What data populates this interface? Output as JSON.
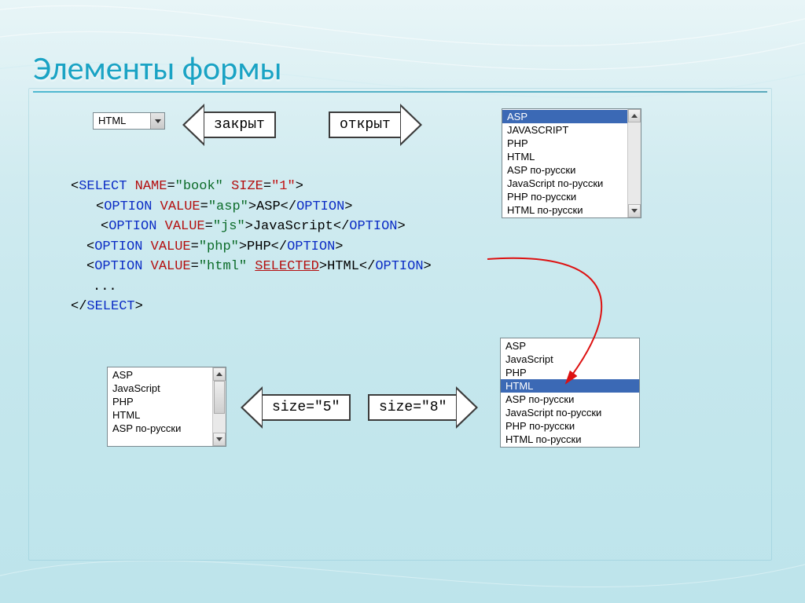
{
  "title": "Элементы формы",
  "arrows": {
    "closed": "закрыт",
    "open": "открыт",
    "size5": "size=\"5\"",
    "size8": "size=\"8\""
  },
  "select_closed_value": "HTML",
  "list_open": {
    "selected_index": 0,
    "items": [
      "ASP",
      "JAVASCRIPT",
      "PHP",
      "HTML",
      "ASP по-русски",
      "JavaScript по-русски",
      "PHP по-русски",
      "HTML по-русски"
    ]
  },
  "list5": {
    "items": [
      "ASP",
      "JavaScript",
      "PHP",
      "HTML",
      "ASP по-русски"
    ],
    "scroll_thumb": {
      "top": 0,
      "height": 50
    }
  },
  "list8": {
    "selected_index": 3,
    "items": [
      "ASP",
      "JavaScript",
      "PHP",
      "HTML",
      "ASP по-русски",
      "JavaScript по-русски",
      "PHP по-русски",
      "HTML по-русски"
    ]
  },
  "code": {
    "l1_pre": "<",
    "l1_tag": "SELECT",
    "l1_sp": " NAME=",
    "l1_nameval": "\"book\"",
    "l1_size": " SIZE=",
    "l1_sizeval": "\"1\"",
    "l1_post": ">",
    "opt1_open": "<OPTION VALUE=",
    "opt1_val": "\"asp\"",
    "opt1_mid": ">ASP</",
    "opt1_close": "OPTION",
    "opt2_open": "<OPTION VALUE=",
    "opt2_val": "\"js\"",
    "opt2_mid": ">JavaScript</",
    "opt3_open": "<OPTION VALUE=",
    "opt3_val": "\"php\"",
    "opt3_mid": ">PHP</",
    "opt4_open": "<OPTION VALUE=",
    "opt4_val": "\"html\"",
    "opt4_sel": " SELECTED",
    "opt4_mid": ">HTML</",
    "ellipsis": "...",
    "close": "</SELECT>"
  }
}
